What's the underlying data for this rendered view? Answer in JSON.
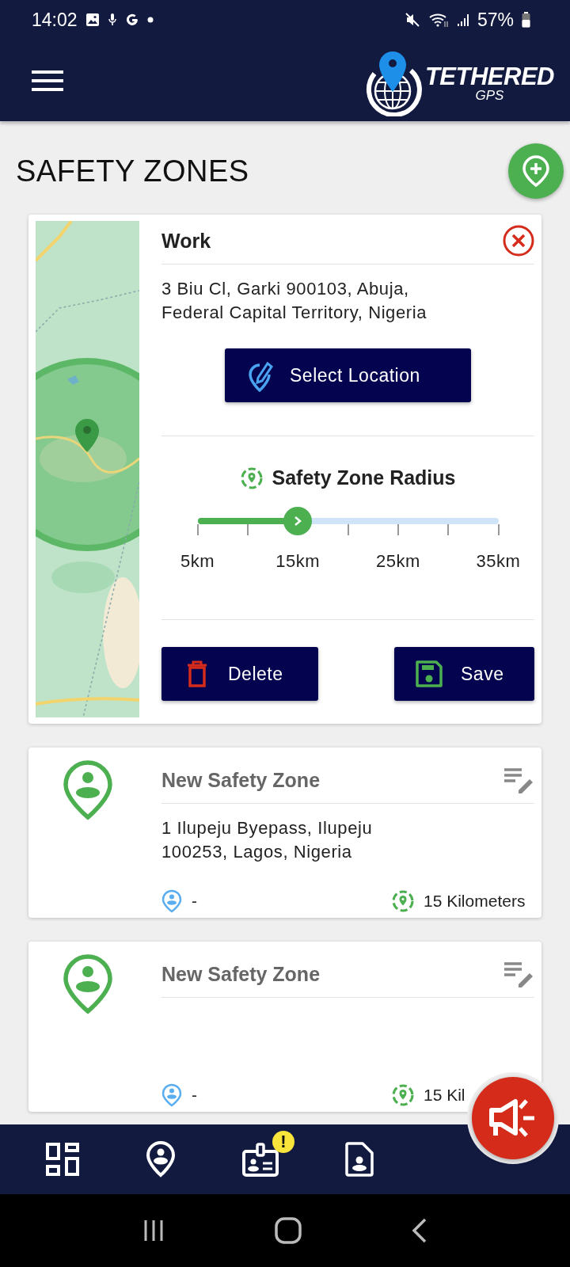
{
  "status_bar": {
    "time": "14:02",
    "battery": "57%"
  },
  "app_bar": {
    "logo_title": "TETHERED",
    "logo_subtitle": "GPS"
  },
  "page": {
    "title": "SAFETY ZONES"
  },
  "zones": [
    {
      "kind": "editing",
      "name": "Work",
      "address": "3 Biu Cl, Garki 900103, Abuja,\nFederal Capital Territory, Nigeria",
      "select_button": "Select Location",
      "radius_label": "Safety Zone Radius",
      "level": 0.3333,
      "tick_labels": [
        "5km",
        "15km",
        "25km",
        "35km"
      ],
      "buttons": [
        {
          "kind": "delete",
          "label": "Delete"
        },
        {
          "kind": "save",
          "label": "Save"
        }
      ]
    },
    {
      "kind": "summary",
      "name": "New Safety Zone",
      "address": "1 Ilupeju Byepass, Ilupeju\n100253, Lagos, Nigeria",
      "person": "-",
      "radius": "15 Kilometers"
    },
    {
      "kind": "summary",
      "name": "New Safety Zone",
      "person": "-",
      "radius": "15 Kil"
    }
  ],
  "bottom_nav": [
    {
      "kind": "dashboard"
    },
    {
      "kind": "zones"
    },
    {
      "kind": "id",
      "badge": "!"
    },
    {
      "kind": "document"
    }
  ]
}
